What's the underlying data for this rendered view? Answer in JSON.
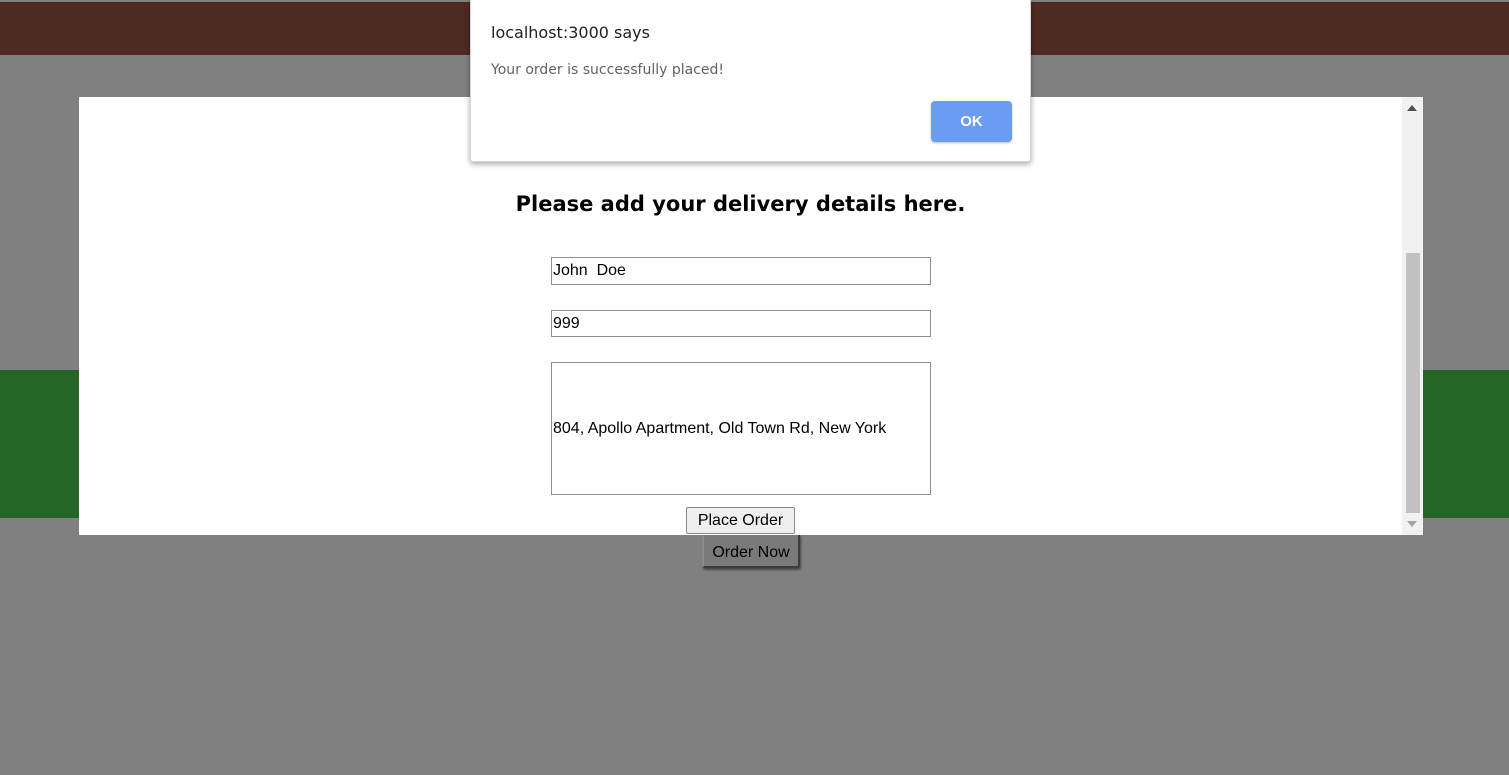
{
  "alert": {
    "title": "localhost:3000 says",
    "message": "Your order is successfully placed!",
    "ok_label": "OK"
  },
  "modal": {
    "heading": "Please add your delivery details here.",
    "name_value": "John  Doe",
    "phone_value": "999",
    "address_value": "804, Apollo Apartment, Old Town Rd, New York",
    "place_order_label": "Place Order"
  },
  "background": {
    "order_now_label": "Order Now"
  },
  "colors": {
    "overlay": "#808080",
    "top_bar": "#4e2b22",
    "green_band": "#256628",
    "ok_button": "#6b9cf4"
  }
}
